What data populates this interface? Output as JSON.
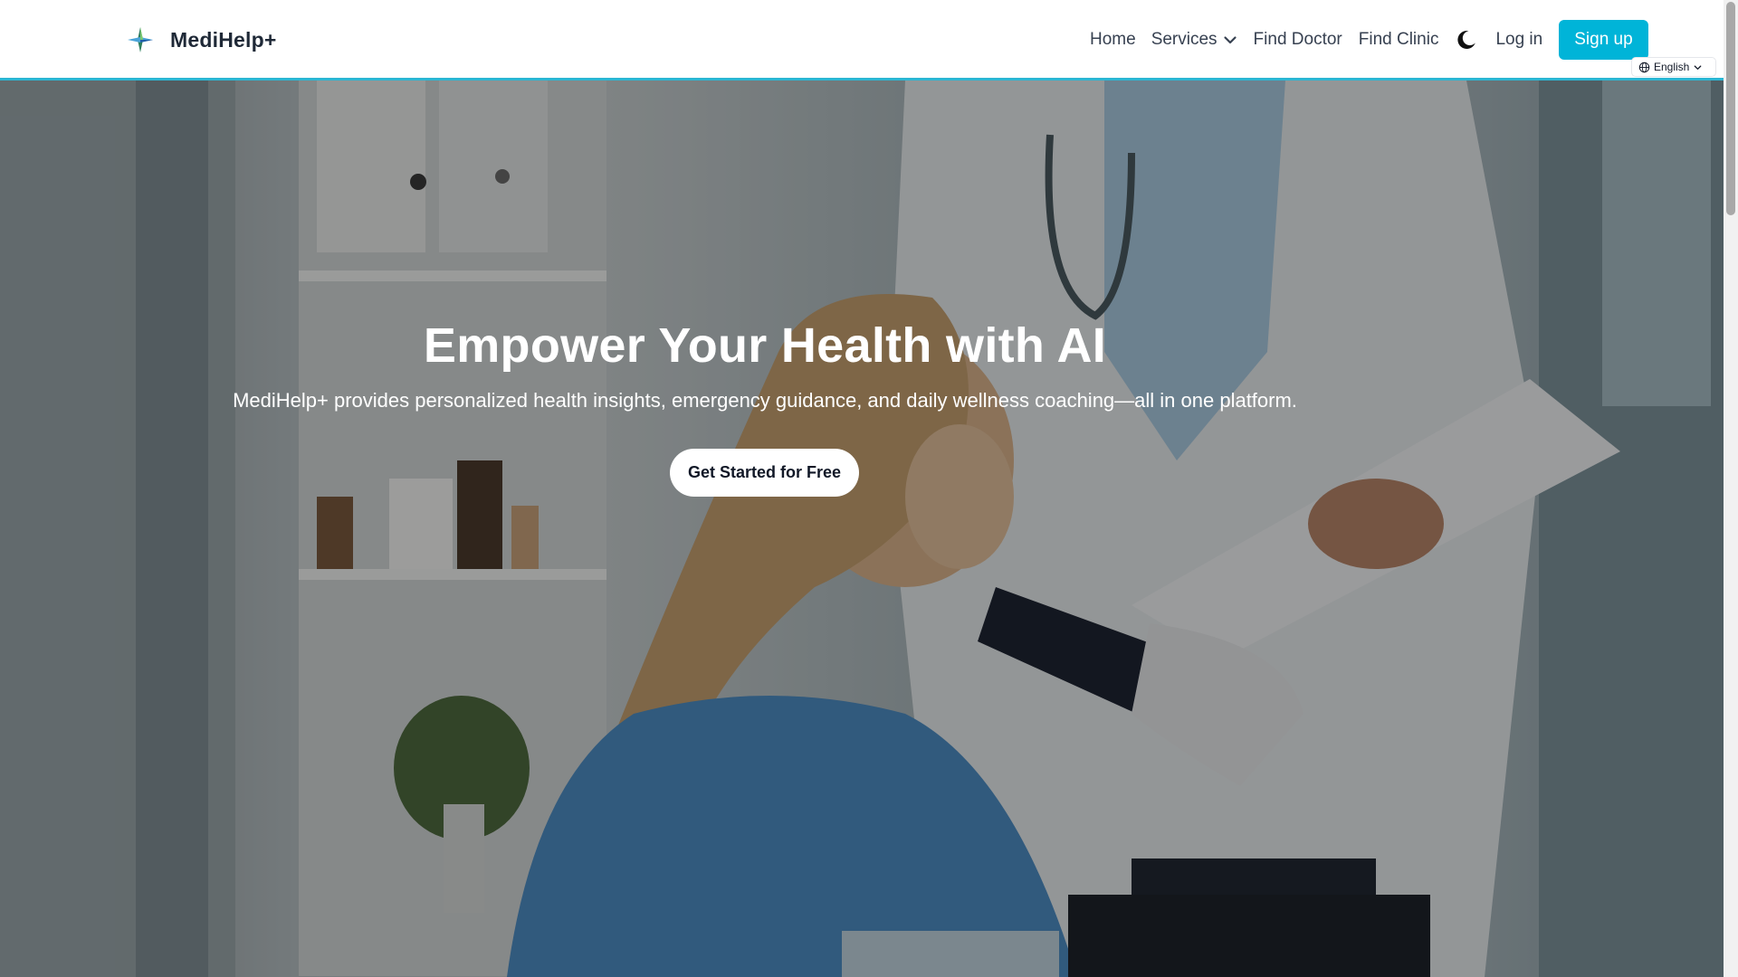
{
  "brand": {
    "name": "MediHelp+"
  },
  "nav": {
    "home": "Home",
    "services": "Services",
    "find_doctor": "Find Doctor",
    "find_clinic": "Find Clinic",
    "login": "Log in",
    "signup": "Sign up",
    "theme_toggle_icon": "moon-icon"
  },
  "language": {
    "selected": "English",
    "icon": "globe-icon"
  },
  "hero": {
    "title": "Empower Your Health with AI",
    "subtitle": "MediHelp+ provides personalized health insights, emergency guidance, and daily wellness coaching—all in one platform.",
    "cta": "Get Started for Free"
  },
  "colors": {
    "accent": "#00b4d8",
    "header_border": "#2bb6d3",
    "text_dark": "#1f2937"
  }
}
